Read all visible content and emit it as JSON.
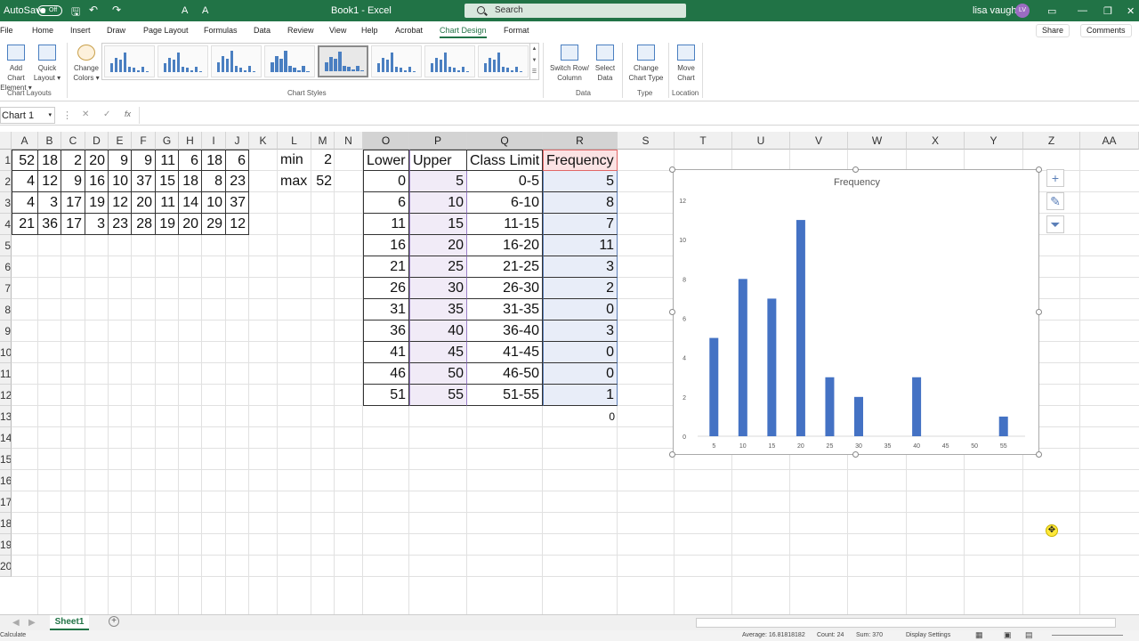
{
  "titlebar": {
    "autosave": "AutoSave",
    "autosave_state": "Off",
    "doc_title": "Book1 - Excel",
    "search_placeholder": "Search",
    "user": "lisa vaughn",
    "initials": "LV"
  },
  "tabs": [
    "File",
    "Home",
    "Insert",
    "Draw",
    "Page Layout",
    "Formulas",
    "Data",
    "Review",
    "View",
    "Help",
    "Acrobat",
    "Chart Design",
    "Format"
  ],
  "share": "Share",
  "comments": "Comments",
  "ribbon": {
    "add_chart_element": [
      "Add Chart",
      "Element ▾"
    ],
    "quick_layout": [
      "Quick",
      "Layout ▾"
    ],
    "change_colors": [
      "Change",
      "Colors ▾"
    ],
    "switch_row_column": [
      "Switch Row/",
      "Column"
    ],
    "select_data": [
      "Select",
      "Data"
    ],
    "change_chart_type": [
      "Change",
      "Chart Type"
    ],
    "move_chart": [
      "Move",
      "Chart"
    ],
    "groups": {
      "chart_layouts": "Chart Layouts",
      "chart_styles": "Chart Styles",
      "data": "Data",
      "type": "Type",
      "location": "Location"
    }
  },
  "formula": {
    "name_box": "Chart 1",
    "fx": "fx",
    "cancel": "✕",
    "enter": "✓"
  },
  "columns": [
    "A",
    "B",
    "C",
    "D",
    "E",
    "F",
    "G",
    "H",
    "I",
    "J",
    "K",
    "L",
    "M",
    "N",
    "O",
    "P",
    "Q",
    "R",
    "S",
    "T",
    "U",
    "V",
    "W",
    "X",
    "Y",
    "Z",
    "AA"
  ],
  "rows": [
    "1",
    "2",
    "3",
    "4",
    "5",
    "6",
    "7",
    "8",
    "9",
    "10",
    "11",
    "12",
    "13",
    "14",
    "15",
    "16",
    "17",
    "18",
    "19",
    "20"
  ],
  "raw_data": [
    [
      "52",
      "18",
      "2",
      "20",
      "9",
      "9",
      "11",
      "6",
      "18",
      "6"
    ],
    [
      "4",
      "12",
      "9",
      "16",
      "10",
      "37",
      "15",
      "18",
      "8",
      "23"
    ],
    [
      "4",
      "3",
      "17",
      "19",
      "12",
      "20",
      "11",
      "14",
      "10",
      "37"
    ],
    [
      "21",
      "36",
      "17",
      "3",
      "23",
      "28",
      "19",
      "20",
      "29",
      "12"
    ]
  ],
  "stats": [
    [
      "min",
      "2"
    ],
    [
      "max",
      "52"
    ]
  ],
  "freq_headers": [
    "Lower",
    "Upper",
    "Class Limit",
    "Frequency"
  ],
  "freq_rows": [
    [
      "0",
      "5",
      "0-5",
      "5"
    ],
    [
      "6",
      "10",
      "6-10",
      "8"
    ],
    [
      "11",
      "15",
      "11-15",
      "7"
    ],
    [
      "16",
      "20",
      "16-20",
      "11"
    ],
    [
      "21",
      "25",
      "21-25",
      "3"
    ],
    [
      "26",
      "30",
      "26-30",
      "2"
    ],
    [
      "31",
      "35",
      "31-35",
      "0"
    ],
    [
      "36",
      "40",
      "36-40",
      "3"
    ],
    [
      "41",
      "45",
      "41-45",
      "0"
    ],
    [
      "46",
      "50",
      "46-50",
      "0"
    ],
    [
      "51",
      "55",
      "51-55",
      "1"
    ]
  ],
  "r13": "0",
  "chart_data": {
    "type": "bar",
    "title": "Frequency",
    "categories": [
      "5",
      "10",
      "15",
      "20",
      "25",
      "30",
      "35",
      "40",
      "45",
      "50",
      "55"
    ],
    "values": [
      5,
      8,
      7,
      11,
      3,
      2,
      0,
      3,
      0,
      0,
      1
    ],
    "yticks": [
      "0",
      "2",
      "4",
      "6",
      "8",
      "10",
      "12"
    ],
    "ylim": [
      0,
      12
    ],
    "color": "#4472c4"
  },
  "sheet_tab": "Sheet1",
  "status": {
    "ready": "Calculate",
    "average": "Average: 16.81818182",
    "count": "Count: 24",
    "sum": "Sum: 370",
    "display": "Display Settings"
  },
  "colors": {
    "excel_green": "#217346",
    "bar": "#4472c4",
    "freq_header_bg": "#fbe3e4",
    "selection_bg": "#e8edf8",
    "upper_bg": "#f1ebf7"
  }
}
